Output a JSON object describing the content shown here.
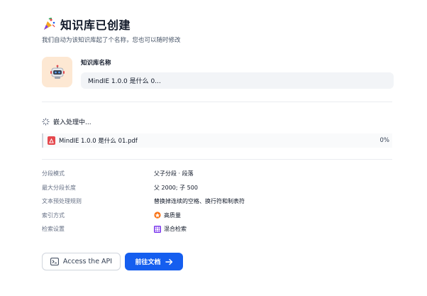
{
  "header": {
    "title": "知识库已创建",
    "subtitle": "我们自动为该知识库起了个名称，您也可以随时修改"
  },
  "kb": {
    "label": "知识库名称",
    "name_value": "MindIE 1.0.0 是什么 0..."
  },
  "embedding": {
    "status": "嵌入处理中...",
    "file": {
      "name": "MindIE 1.0.0 是什么 01.pdf",
      "progress": "0%"
    }
  },
  "meta": [
    {
      "key": "分段模式",
      "value": "父子分段 · 段落",
      "icon": ""
    },
    {
      "key": "最大分段长度",
      "value": "父 2000; 子 500",
      "icon": ""
    },
    {
      "key": "文本预处理规则",
      "value": "替换掉连续的空格、换行符和制表符",
      "icon": ""
    },
    {
      "key": "索引方式",
      "value": "高质量",
      "icon": "high-quality-icon"
    },
    {
      "key": "检索设置",
      "value": "混合检索",
      "icon": "hybrid-search-icon"
    }
  ],
  "actions": {
    "api_label": "Access the API",
    "doc_label": "前往文档"
  },
  "colors": {
    "primary": "#155eef",
    "pdf": "#e5484d",
    "avatar_bg": "#fde8d3",
    "high_quality": "#f97316",
    "hybrid": "#7c3aed"
  }
}
